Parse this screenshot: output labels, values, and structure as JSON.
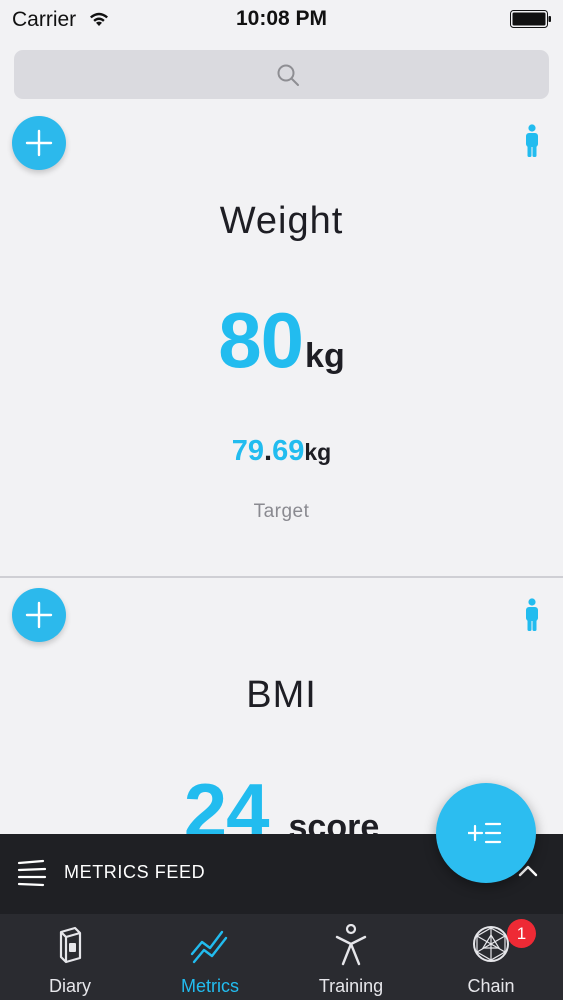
{
  "status_bar": {
    "carrier": "Carrier",
    "time": "10:08 PM"
  },
  "search": {
    "icon": "search-icon"
  },
  "metrics": [
    {
      "title": "Weight",
      "value": "80",
      "unit": "kg",
      "target_int": "79",
      "target_dot": ".",
      "target_dec": "69",
      "target_unit": "kg",
      "target_label": "Target"
    },
    {
      "title": "BMI",
      "value": "24",
      "unit": "score"
    }
  ],
  "feed": {
    "title": "METRICS FEED"
  },
  "tabs": [
    {
      "label": "Diary",
      "icon": "diary-icon",
      "active": false
    },
    {
      "label": "Metrics",
      "icon": "metrics-icon",
      "active": true
    },
    {
      "label": "Training",
      "icon": "training-icon",
      "active": false
    },
    {
      "label": "Chain",
      "icon": "chain-icon",
      "active": false,
      "badge": "1"
    }
  ],
  "colors": {
    "accent": "#22bcef",
    "badge": "#ee2a35",
    "dark_bar": "#1f2024",
    "tab_bar": "#2a2b30"
  }
}
